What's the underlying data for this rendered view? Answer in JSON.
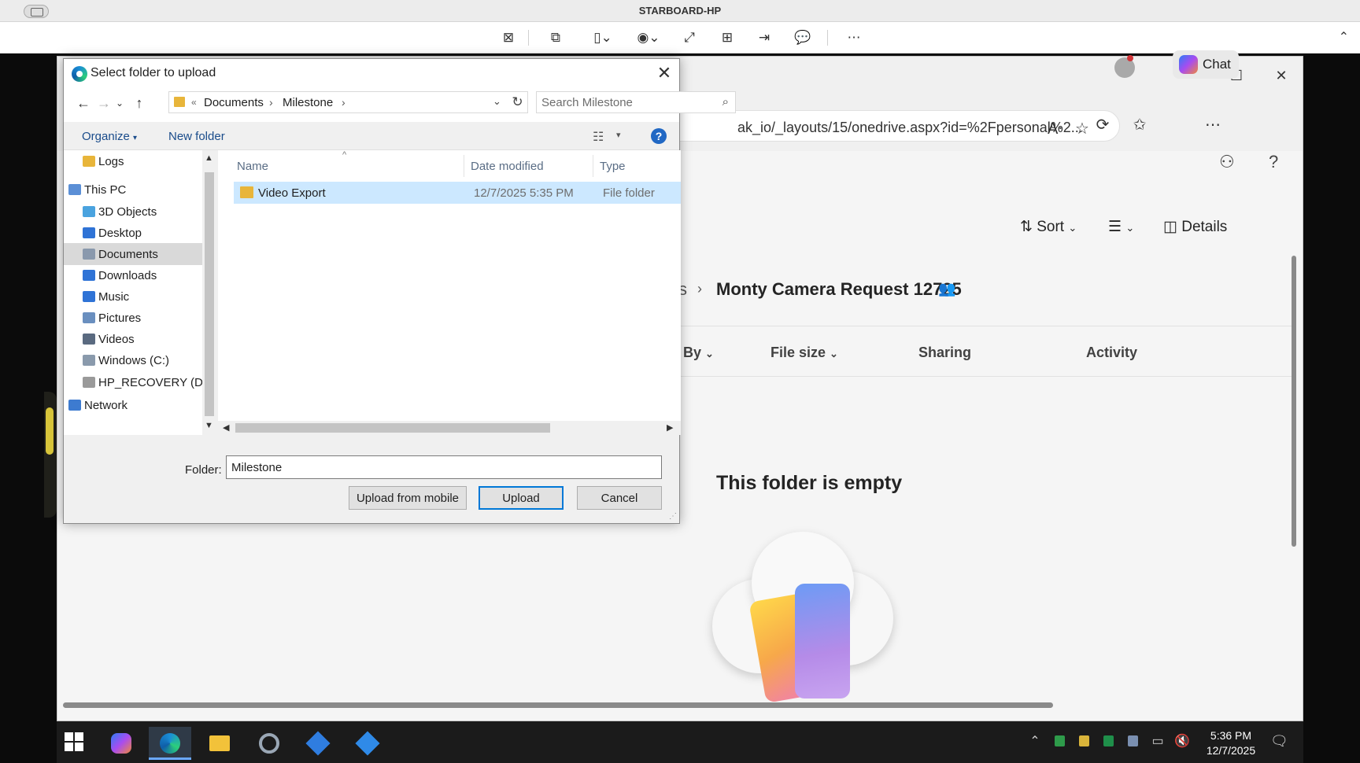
{
  "remote_session": {
    "title": "STARBOARD-HP",
    "toolbar_icons": [
      "disconnect-icon",
      "switch-display-icon",
      "display-select-icon",
      "view-options-icon",
      "fullscreen-icon",
      "fit-window-icon",
      "send-keys-icon",
      "chat-icon",
      "more-icon"
    ]
  },
  "browser": {
    "address": "ak_io/_layouts/15/onedrive.aspx?id=%2Fpersonal%2...",
    "chat_label": "Chat"
  },
  "onedrive": {
    "commands": {
      "sort": "Sort",
      "details": "Details"
    },
    "breadcrumb_partial": "s",
    "folder_title": "Monty Camera Request 12725",
    "columns": [
      "By",
      "File size",
      "Sharing",
      "Activity"
    ],
    "empty_message": "This folder is empty"
  },
  "dialog": {
    "title": "Select folder to upload",
    "path": {
      "overflow": "«",
      "segments": [
        "Documents",
        "Milestone"
      ]
    },
    "search_placeholder": "Search Milestone",
    "commands": {
      "organize": "Organize",
      "new_folder": "New folder",
      "help": "?"
    },
    "nav_items": [
      {
        "label": "Logs",
        "icon": "folder-icon",
        "color": "#e8b53a",
        "selected": false
      },
      {
        "label": "This PC",
        "icon": "computer-icon",
        "color": "#5b8fd6",
        "selected": false
      },
      {
        "label": "3D Objects",
        "icon": "3d-objects-icon",
        "color": "#4aa3df",
        "selected": false
      },
      {
        "label": "Desktop",
        "icon": "desktop-icon",
        "color": "#2f73d6",
        "selected": false
      },
      {
        "label": "Documents",
        "icon": "documents-icon",
        "color": "#8a99ad",
        "selected": true
      },
      {
        "label": "Downloads",
        "icon": "downloads-icon",
        "color": "#2f73d6",
        "selected": false
      },
      {
        "label": "Music",
        "icon": "music-icon",
        "color": "#2f73d6",
        "selected": false
      },
      {
        "label": "Pictures",
        "icon": "pictures-icon",
        "color": "#6a8fbf",
        "selected": false
      },
      {
        "label": "Videos",
        "icon": "videos-icon",
        "color": "#5a6a80",
        "selected": false
      },
      {
        "label": "Windows (C:)",
        "icon": "drive-icon",
        "color": "#8a9aac",
        "selected": false
      },
      {
        "label": "HP_RECOVERY (D:)",
        "icon": "drive-icon",
        "color": "#9a9a9a",
        "selected": false
      },
      {
        "label": "Network",
        "icon": "network-icon",
        "color": "#3d7bd0",
        "selected": false
      }
    ],
    "file_columns": [
      "Name",
      "Date modified",
      "Type"
    ],
    "files": [
      {
        "name": "Video Export",
        "date": "12/7/2025 5:35 PM",
        "type": "File folder"
      }
    ],
    "folder_label": "Folder:",
    "folder_value": "Milestone",
    "buttons": {
      "upload_mobile": "Upload from mobile",
      "upload": "Upload",
      "cancel": "Cancel"
    }
  },
  "taskbar": {
    "apps": [
      "copilot-icon",
      "edge-icon",
      "file-explorer-icon",
      "cortana-icon",
      "remote-app-icon",
      "settings-app-icon"
    ],
    "active_app": "edge-icon",
    "time": "5:36 PM",
    "date": "12/7/2025"
  }
}
